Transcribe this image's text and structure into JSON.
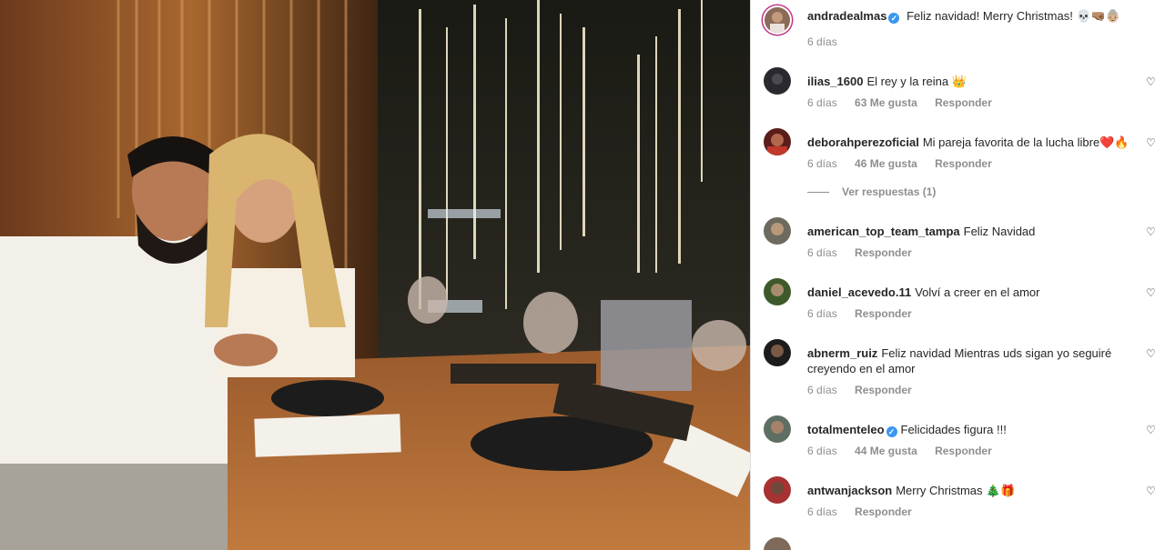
{
  "post": {
    "author": "andradealmas",
    "caption": "Feliz navidad! Merry Christmas! 💀🤜🏽👵🏼",
    "time": "6 días"
  },
  "labels": {
    "likes_suffix": "Me gusta",
    "reply": "Responder",
    "view_replies": "Ver respuestas (1)"
  },
  "comments": [
    {
      "user": "ilias_1600",
      "text": "El rey y la reina 👑",
      "time": "6 días",
      "likes": "63 Me gusta",
      "verified": false
    },
    {
      "user": "deborahperezoficial",
      "text": "Mi pareja favorita de la lucha libre❤️🔥",
      "time": "6 días",
      "likes": "46 Me gusta",
      "verified": false
    },
    {
      "user": "american_top_team_tampa",
      "text": "Feliz Navidad",
      "time": "6 días",
      "likes": "",
      "verified": false
    },
    {
      "user": "daniel_acevedo.11",
      "text": "Volví a creer en el amor",
      "time": "6 días",
      "likes": "",
      "verified": false
    },
    {
      "user": "abnerm_ruiz",
      "text": "Feliz navidad Mientras uds sigan yo seguiré creyendo en el amor",
      "time": "6 días",
      "likes": "",
      "verified": false
    },
    {
      "user": "totalmenteleo",
      "text": "Felicidades figura !!!",
      "time": "6 días",
      "likes": "44 Me gusta",
      "verified": true
    },
    {
      "user": "antwanjackson",
      "text": "Merry Christmas 🎄🎁",
      "time": "6 días",
      "likes": "",
      "verified": false
    }
  ],
  "colors": {
    "accent": "#3897f0",
    "muted": "#8e8e8e",
    "text": "#262626"
  }
}
